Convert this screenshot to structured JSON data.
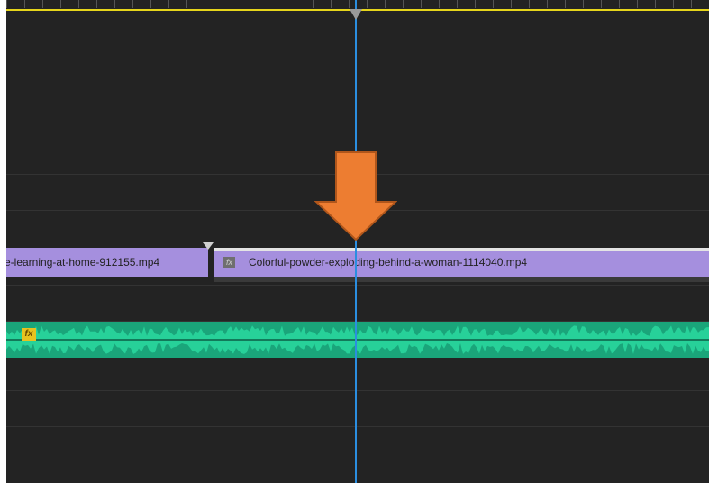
{
  "timeline": {
    "clips": [
      {
        "label": "e-learning-at-home-912155.mp4"
      },
      {
        "label": "Colorful-powder-exploding-behind-a-woman-1114040.mp4"
      }
    ],
    "video_clip_color": "#a58fde",
    "audio_clip_color": "#1aa57a",
    "playhead_color": "#2b8ee0",
    "work_area_color": "#e6d51b",
    "audio_fx_badge": "fx",
    "video_fx_badge": "fx"
  },
  "annotation": {
    "arrow_color": "#ed7d31",
    "arrow_icon": "down-arrow-icon"
  }
}
